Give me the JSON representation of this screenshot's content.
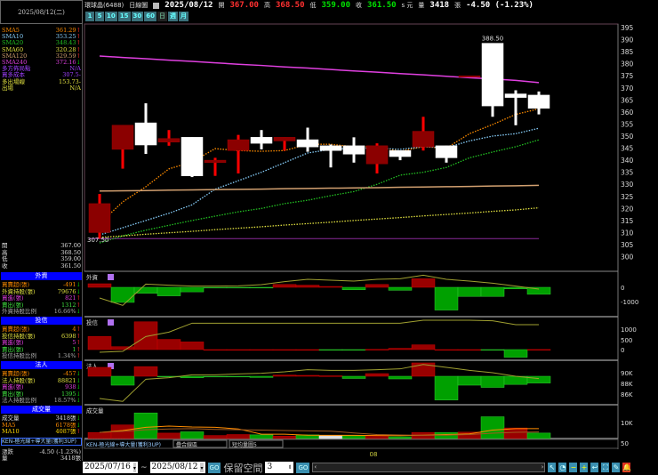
{
  "header": {
    "stock": "環球晶(6488)",
    "chart_type": "日線圖",
    "date": "2025/08/12",
    "open_label": "開",
    "open": "367.00",
    "high_label": "高",
    "high": "368.50",
    "low_label": "低",
    "low": "359.00",
    "close_label": "收",
    "close": "361.50",
    "unit": "s 元",
    "vol_label": "量",
    "volume": "3418",
    "vol_unit": "張",
    "change": "-4.50 (-1.23%)"
  },
  "toolbar": {
    "periods": [
      "1",
      "5",
      "10",
      "15",
      "30",
      "60",
      "日",
      "週",
      "月"
    ],
    "selected": "日"
  },
  "left": {
    "date": "2025/08/12(二)",
    "ma_rows": [
      {
        "label": "SMA5",
        "value": "361.29",
        "arrow": "↑",
        "color": "#ff8c00",
        "dir": "up"
      },
      {
        "label": "SMA10",
        "value": "353.25",
        "arrow": "↑",
        "color": "#87cefa",
        "dir": "up"
      },
      {
        "label": "SMA20",
        "value": "348.43",
        "arrow": "↑",
        "color": "#22c022",
        "dir": "up"
      },
      {
        "label": "SMA60",
        "value": "320.28",
        "arrow": "↑",
        "color": "#e0e040",
        "dir": "up"
      },
      {
        "label": "SMA120",
        "value": "329.59",
        "arrow": "↑",
        "color": "#d2a070",
        "dir": "up"
      },
      {
        "label": "SMA240",
        "value": "372.16",
        "arrow": "↓",
        "color": "#e040e0",
        "dir": "dn"
      },
      {
        "label": "多方佈局點",
        "value": "N/A",
        "arrow": "",
        "color": "#a040ff",
        "dir": ""
      },
      {
        "label": "買多成本",
        "value": "307.5-",
        "arrow": "",
        "color": "#a040ff",
        "dir": ""
      },
      {
        "label": "多出場線",
        "value": "153.73-",
        "arrow": "",
        "color": "#e0e040",
        "dir": ""
      },
      {
        "label": "出場",
        "value": "N/A",
        "arrow": "",
        "color": "#e0e040",
        "dir": ""
      }
    ],
    "ohlc": [
      {
        "label": "開",
        "value": "367.00"
      },
      {
        "label": "高",
        "value": "368.50"
      },
      {
        "label": "低",
        "value": "359.00"
      },
      {
        "label": "收",
        "value": "361.50"
      }
    ],
    "sections": [
      {
        "title": "外資",
        "rows": [
          {
            "label": "買賣超(張)",
            "value": "-491",
            "arrow": "↓",
            "color": "#ff8c00",
            "dir": "dn"
          },
          {
            "label": "外資持股(張)",
            "value": "79676",
            "arrow": "↓",
            "color": "#e0e040",
            "dir": "dn"
          },
          {
            "label": "買進(張)",
            "value": "821",
            "arrow": "↑",
            "color": "#e040e0",
            "dir": "up"
          },
          {
            "label": "賣出(張)",
            "value": "1312",
            "arrow": "↑",
            "color": "#40e040",
            "dir": "up"
          },
          {
            "label": "外資持股比例",
            "value": "16.66%",
            "arrow": "↓",
            "color": "#aaaaaa",
            "dir": "dn"
          }
        ]
      },
      {
        "title": "投信",
        "rows": [
          {
            "label": "買賣超(張)",
            "value": "4",
            "arrow": "↑",
            "color": "#ff8c00",
            "dir": "up"
          },
          {
            "label": "投信持股(張)",
            "value": "6398",
            "arrow": "↑",
            "color": "#e0e040",
            "dir": "up"
          },
          {
            "label": "買進(張)",
            "value": "5",
            "arrow": "↑",
            "color": "#e040e0",
            "dir": "up"
          },
          {
            "label": "賣出(張)",
            "value": "1",
            "arrow": "↑",
            "color": "#40e040",
            "dir": "up"
          },
          {
            "label": "投信持股比例",
            "value": "1.34%",
            "arrow": "↑",
            "color": "#aaaaaa",
            "dir": "up"
          }
        ]
      },
      {
        "title": "法人",
        "rows": [
          {
            "label": "買賣超(張)",
            "value": "-457",
            "arrow": "↓",
            "color": "#ff8c00",
            "dir": "dn"
          },
          {
            "label": "法人持股(張)",
            "value": "88821",
            "arrow": "↓",
            "color": "#e0e040",
            "dir": "dn"
          },
          {
            "label": "買進(張)",
            "value": "938",
            "arrow": "↓",
            "color": "#e040e0",
            "dir": "dn"
          },
          {
            "label": "賣出(張)",
            "value": "1395",
            "arrow": "↓",
            "color": "#40e040",
            "dir": "dn"
          },
          {
            "label": "法人持股比例",
            "value": "18.57%",
            "arrow": "↓",
            "color": "#aaaaaa",
            "dir": "dn"
          }
        ]
      },
      {
        "title": "成交量",
        "rows": [
          {
            "label": "成交量",
            "value": "3418張",
            "arrow": "↓",
            "color": "#dddddd",
            "dir": "dn"
          },
          {
            "label": "MA5",
            "value": "6178張",
            "arrow": "↓",
            "color": "#ff8c00",
            "dir": "dn"
          },
          {
            "label": "MA10",
            "value": "4087張",
            "arrow": "↑",
            "color": "#ffd700",
            "dir": "up"
          }
        ]
      }
    ],
    "strategy": "KEN-極光線+導大量(獲利3UP)",
    "change_label": "漲跌",
    "change": "-4.50 (-1.23%)",
    "vol_label": "量",
    "vol": "3418張"
  },
  "chart_data": [
    {
      "type": "candlestick",
      "name": "price",
      "ylim": [
        300,
        395
      ],
      "yticks": [
        395,
        390,
        385,
        380,
        375,
        370,
        365,
        360,
        355,
        350,
        345,
        340,
        335,
        330,
        325,
        320,
        315,
        310,
        305,
        300
      ],
      "ohlc": [
        [
          310,
          326,
          307.5,
          322
        ],
        [
          344.5,
          354.5,
          336.5,
          354.5
        ],
        [
          355.5,
          363.6,
          342.6,
          346.3
        ],
        [
          347.5,
          352.5,
          346,
          349
        ],
        [
          349.5,
          349.5,
          333,
          333.5
        ],
        [
          339,
          341,
          333.5,
          340
        ],
        [
          344,
          350.5,
          334.5,
          348.5
        ],
        [
          349.5,
          352.5,
          344.5,
          347
        ],
        [
          348,
          349.5,
          344,
          349.5
        ],
        [
          348.5,
          353.5,
          343.5,
          345.5
        ],
        [
          346,
          346.5,
          337,
          344
        ],
        [
          346,
          349.5,
          339,
          342.5
        ],
        [
          338.5,
          347,
          334.5,
          346
        ],
        [
          344,
          344,
          340,
          341.5
        ],
        [
          345.5,
          358,
          344,
          352
        ],
        [
          346,
          346,
          339,
          341
        ],
        [
          375,
          375,
          375,
          375
        ],
        [
          388.5,
          388.5,
          358,
          362.5
        ],
        [
          367.5,
          369,
          354.5,
          366
        ],
        [
          367,
          368.5,
          359,
          361.5
        ]
      ],
      "high_label": "388.50",
      "low_label": "307.50",
      "support_line": 307.5,
      "ma": [
        {
          "name": "SMA5",
          "color": "#ff8c00",
          "dash": true,
          "values": [
            313.8,
            322.7,
            329,
            336.4,
            339.3,
            344.8,
            344,
            343.7,
            344,
            346.6,
            346.6,
            345.6,
            345.6,
            343.7,
            345.6,
            345,
            351,
            354.8,
            359,
            361.3
          ]
        },
        {
          "name": "SMA10",
          "color": "#87cefa",
          "dash": true,
          "values": [
            309,
            312,
            315,
            318,
            321.5,
            328,
            331.5,
            335,
            339,
            343,
            344.5,
            345,
            345,
            344.5,
            345.6,
            345.2,
            348,
            350,
            351,
            353.25
          ]
        },
        {
          "name": "SMA20",
          "color": "#22c022",
          "dash": true,
          "values": [
            305.7,
            308.6,
            311,
            313,
            315,
            316.8,
            318.6,
            320,
            322,
            323.4,
            325.3,
            327,
            330,
            333.8,
            335,
            337,
            341,
            343.4,
            345.6,
            348.43
          ]
        },
        {
          "name": "SMA60",
          "color": "#e0e040",
          "dash": true,
          "values": [
            308,
            308.6,
            309.3,
            309.9,
            310.5,
            311.2,
            311.8,
            312.4,
            313.1,
            313.7,
            314.3,
            315,
            315.6,
            316.2,
            316.9,
            317.5,
            318.1,
            318.8,
            319.4,
            320.28
          ]
        },
        {
          "name": "SMA120",
          "color": "#d2a070",
          "dash": false,
          "values": [
            327.2,
            327.3,
            327.4,
            327.6,
            327.7,
            327.8,
            327.9,
            328,
            328.2,
            328.3,
            328.4,
            328.5,
            328.6,
            328.8,
            328.9,
            329,
            329.1,
            329.3,
            329.4,
            329.59
          ]
        },
        {
          "name": "SMA240",
          "color": "#e040e0",
          "dash": false,
          "values": [
            383.2,
            382.6,
            382.1,
            381.5,
            381,
            380.4,
            379.8,
            379.3,
            378.7,
            378.2,
            377.6,
            377,
            376.5,
            375.9,
            375.4,
            374.8,
            374.2,
            373.7,
            373.1,
            372.16
          ]
        }
      ],
      "date_labels": [
        "2025/07/16",
        "08"
      ]
    },
    {
      "type": "bar",
      "name": "外資",
      "yticks": [
        "0",
        "-1000"
      ],
      "values": [
        250,
        -1060,
        -420,
        -600,
        -320,
        -20,
        -20,
        -40,
        200,
        150,
        60,
        -170,
        200,
        -210,
        600,
        -1600,
        -640,
        -640,
        -110,
        -491
      ],
      "holding_line": [
        79076,
        78576,
        80016,
        79936,
        79876,
        79876,
        79896,
        79976,
        80176,
        80336,
        80276,
        80216,
        80336,
        80376,
        80616,
        80336,
        80216,
        80076,
        79876,
        79676
      ]
    },
    {
      "type": "bar",
      "name": "投信",
      "yticks": [
        "1000",
        "500",
        "0"
      ],
      "values": [
        630,
        140,
        1340,
        490,
        370,
        0,
        0,
        0,
        0,
        0,
        -20,
        -30,
        10,
        60,
        230,
        0,
        0,
        -10,
        -370,
        4
      ],
      "holding_line": [
        3143,
        3248,
        4998,
        5523,
        6573,
        6573,
        6573,
        6573,
        6573,
        6573,
        6573,
        6573,
        6573,
        6573,
        6923,
        6923,
        6923,
        6853,
        6398,
        6398
      ]
    },
    {
      "type": "bar",
      "name": "法人",
      "yticks": [
        "90K",
        "88K",
        "86K"
      ],
      "values": [
        600,
        -600,
        650,
        -20,
        -100,
        -20,
        -20,
        -80,
        80,
        60,
        30,
        -150,
        180,
        -180,
        900,
        -1600,
        -600,
        -750,
        -550,
        -457
      ],
      "holding_line": [
        85170,
        84620,
        88780,
        89060,
        89610,
        89610,
        89780,
        89890,
        90170,
        90560,
        90440,
        90440,
        90560,
        90720,
        91550,
        91000,
        90440,
        90000,
        89330,
        88890
      ]
    },
    {
      "type": "bar",
      "name": "成交量",
      "yticks": [
        "10K",
        "50"
      ],
      "values": [
        3800,
        8500,
        16000,
        3400,
        4200,
        1900,
        2500,
        2300,
        1500,
        2300,
        1900,
        1900,
        1900,
        1100,
        3800,
        3800,
        4000,
        13600,
        6600,
        3418
      ],
      "colors": [
        "red",
        "red",
        "green",
        "red",
        "green",
        "red",
        "red",
        "green",
        "red",
        "green",
        "white",
        "green",
        "red",
        "green",
        "red",
        "green",
        "red",
        "green",
        "red",
        "green"
      ],
      "ma5": [
        3800,
        5000,
        7000,
        7800,
        7200,
        7000,
        6000,
        2700,
        2700,
        2100,
        2000,
        2000,
        1900,
        1800,
        2100,
        2500,
        2900,
        5300,
        6200,
        6178
      ],
      "ma10": [
        3800,
        4500,
        5500,
        6000,
        6200,
        5700,
        5500,
        5300,
        5000,
        4800,
        4600,
        3500,
        2500,
        2200,
        2000,
        2100,
        2500,
        3300,
        3900,
        4087
      ]
    }
  ],
  "panel_selectors": {
    "overlay": "疊合線區",
    "volume": "短均量圖5"
  },
  "bottom": {
    "start": "2025/07/16",
    "tilde": "~",
    "end": "2025/08/12",
    "go": "GO",
    "reserve_label": "保留空間",
    "reserve": "3"
  }
}
